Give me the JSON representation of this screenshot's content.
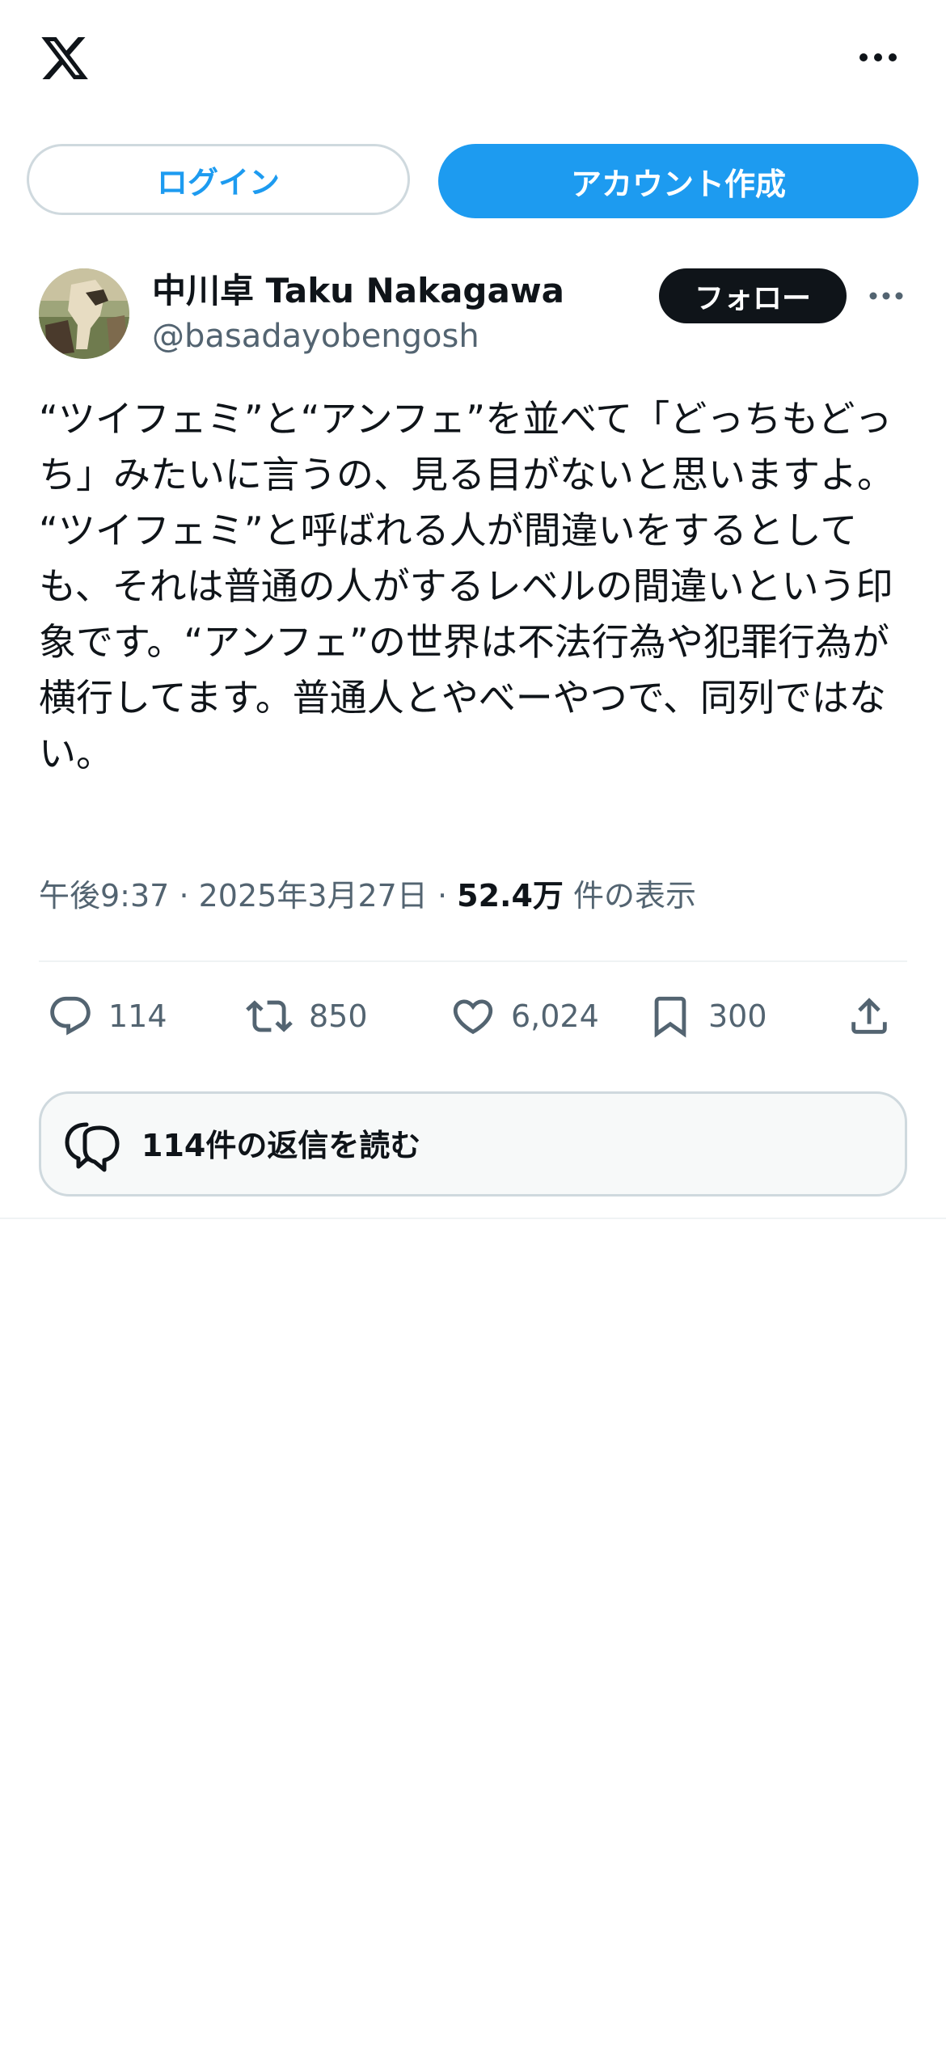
{
  "topbar": {
    "logo_icon": "x-logo-icon",
    "more_icon": "more-horizontal-icon"
  },
  "auth": {
    "login_label": "ログイン",
    "signup_label": "アカウント作成"
  },
  "post": {
    "author": {
      "display_name": "中川卓 Taku Nakagawa",
      "handle": "@basadayobengosh",
      "avatar_icon": "avatar-image",
      "follow_label": "フォロー",
      "more_icon": "more-horizontal-icon"
    },
    "text": "“ツイフェミ”と“アンフェ”を並べて「どっちもどっち」みたいに言うの、見る目がないと思いますよ。\n“ツイフェミ”と呼ばれる人が間違いをするとしても、それは普通の人がするレベルの間違いという印象です。“アンフェ”の世界は不法行為や犯罪行為が横行してます。普通人とやべーやつで、同列ではない。",
    "time": "午後9:37",
    "separator": "·",
    "date": "2025年3月27日",
    "views_count": "52.4万",
    "views_label": "件の表示",
    "actions": {
      "replies": {
        "icon": "reply-icon",
        "count": "114"
      },
      "reposts": {
        "icon": "repost-icon",
        "count": "850"
      },
      "likes": {
        "icon": "heart-icon",
        "count": "6,024"
      },
      "bookmarks": {
        "icon": "bookmark-icon",
        "count": "300"
      },
      "share": {
        "icon": "share-icon"
      }
    },
    "read_replies_label": "114件の返信を読む"
  },
  "colors": {
    "accent": "#1d9bf0",
    "text_primary": "#0f1419",
    "text_secondary": "#536471",
    "border": "#cfd9de"
  }
}
